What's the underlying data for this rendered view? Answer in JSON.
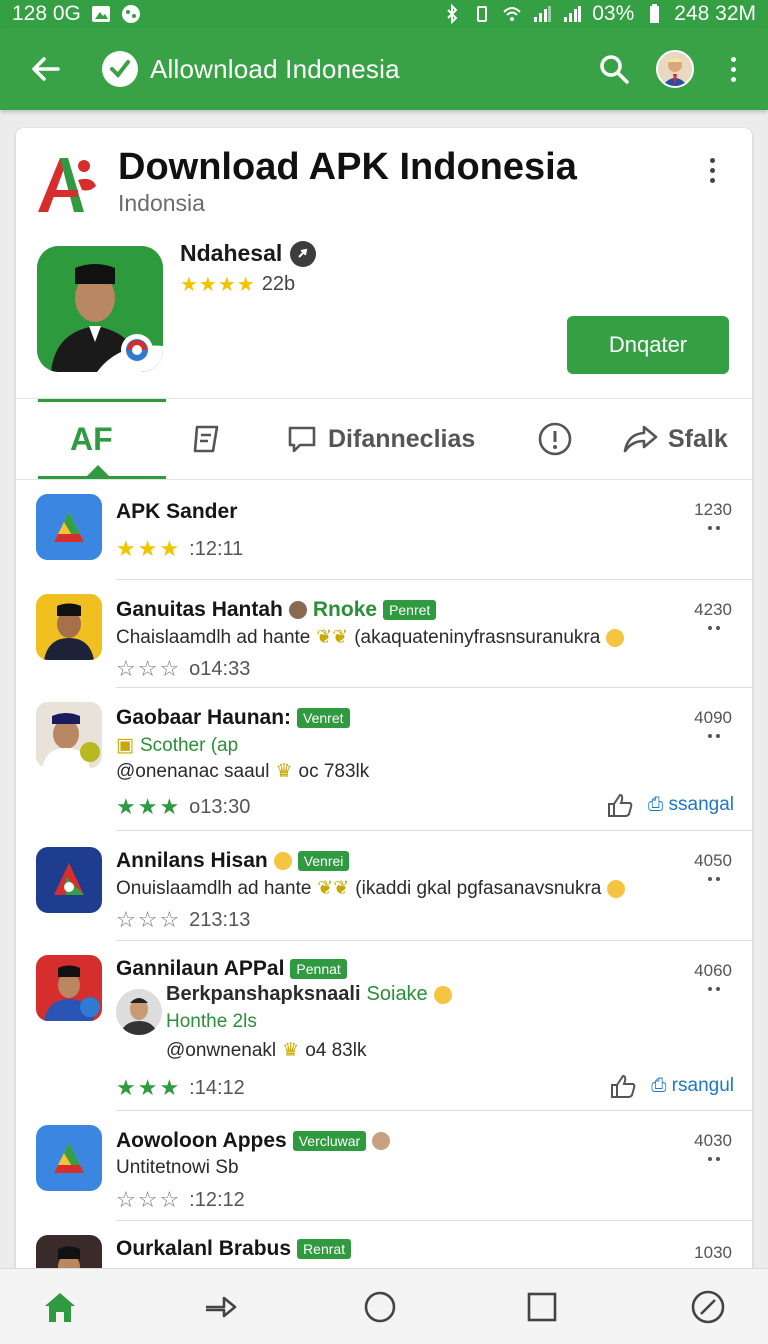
{
  "status_bar": {
    "left_text": "128 0G",
    "right_text": "03%",
    "right_text2": "248 32M"
  },
  "toolbar": {
    "title": "Allownload Indonesia"
  },
  "app": {
    "title": "Download APK Indonesia",
    "subtitle": "Indonsia",
    "developer": "Ndahesal",
    "rating_count": "22b",
    "install_label": "Dnqater"
  },
  "tabs": [
    {
      "label": "AF"
    },
    {
      "label": ""
    },
    {
      "label": "Difanneclias"
    },
    {
      "label": ""
    },
    {
      "label": "Sfalk"
    }
  ],
  "list": [
    {
      "title": "APK Sander",
      "time": ":12:11",
      "count": "1230"
    },
    {
      "title": "Ganuitas Hantah",
      "badge1": "Rnoke",
      "badge2": "Penret",
      "line1": "Chaislaamdlh ad hante",
      "line1b": "(akaquateninyfrasnsuranukra",
      "time": "o14:33",
      "count": "4230"
    },
    {
      "title": "Gaobaar Haunan:",
      "badge1": "Venret",
      "line1": "Scother (ap",
      "line2": "@onenanac saaul",
      "line2b": "oc 783lk",
      "time": "o13:30",
      "count": "4090",
      "action": "ssangal"
    },
    {
      "title": "Annilans Hisan",
      "badge1": "Venrei",
      "line1": "Onuislaamdlh ad hante",
      "line1b": "(ikaddi gkal pgfasanavsnukra",
      "time": "213:13",
      "count": "4050"
    },
    {
      "title": "Gannilaun APPal",
      "badge1": "Pennat",
      "line1": "Berkpanshaрksnaali",
      "line1b": "Soiake",
      "line2": "Honthe 2ls",
      "line3": "@onwnenakl",
      "line3b": "o4 83lk",
      "time": ":14:12",
      "count": "4060",
      "action": "rsangul"
    },
    {
      "title": "Aowoloon Appes",
      "badge1": "Vercluwar",
      "line1": "Untitetnowi Sb",
      "time": ":12:12",
      "count": "4030"
    },
    {
      "title": "Ourkalanl Brabus",
      "badge1": "Renrat",
      "count": "1030"
    }
  ]
}
